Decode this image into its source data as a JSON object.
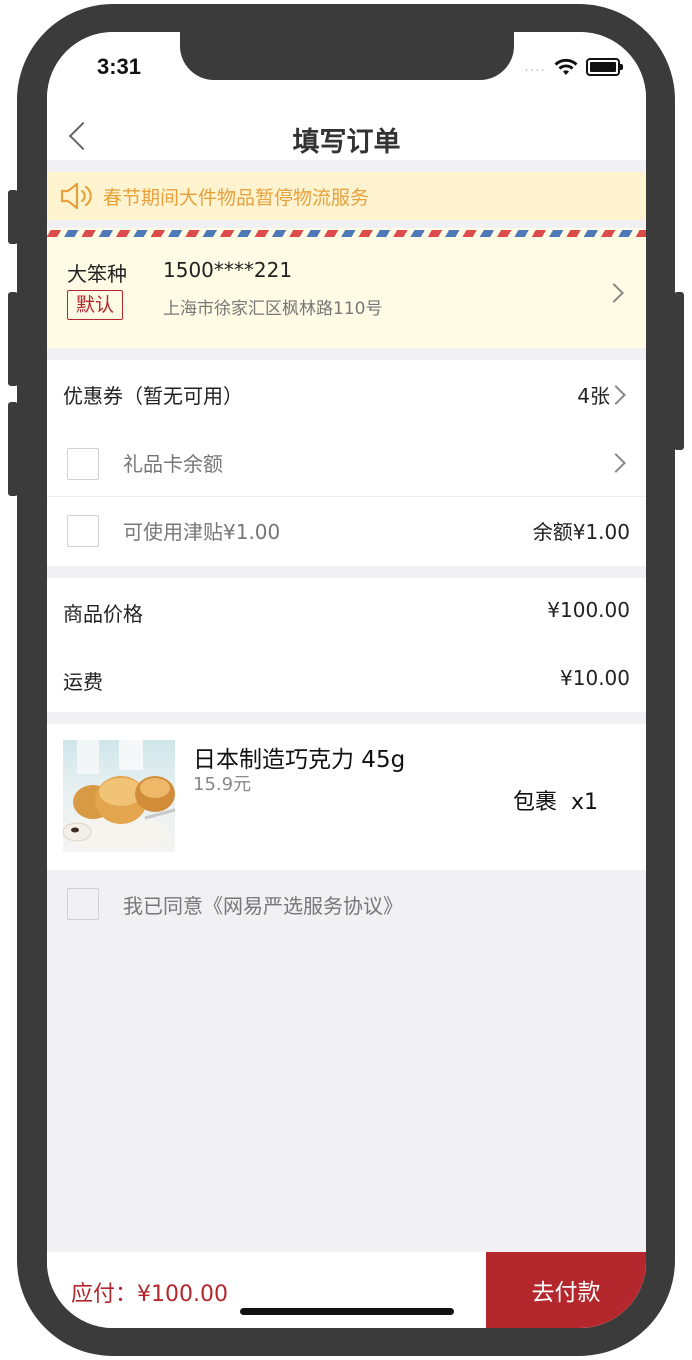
{
  "status_bar": {
    "time": "3:31",
    "signal": "....",
    "wifi_icon": "wifi-icon",
    "battery_icon": "battery-icon"
  },
  "nav": {
    "title": "填写订单",
    "back_icon": "chevron-left-icon"
  },
  "notice": {
    "icon": "speaker-icon",
    "text": "春节期间大件物品暂停物流服务"
  },
  "address": {
    "name": "大笨种",
    "phone": "1500****221",
    "badge": "默认",
    "detail": "上海市徐家汇区枫林路110号"
  },
  "discounts": {
    "coupon_label": "优惠券（暂无可用）",
    "coupon_count": "4张",
    "gift_card_label": "礼品卡余额",
    "allowance_label": "可使用津贴¥1.00",
    "allowance_balance": "余额¥1.00"
  },
  "prices": {
    "goods_label": "商品价格",
    "goods_value": "¥100.00",
    "shipping_label": "运费",
    "shipping_value": "¥10.00"
  },
  "product": {
    "name": "日本制造巧克力 45g",
    "price": "15.9元",
    "package_qty": "包裹  x1"
  },
  "agreement": {
    "text": "我已同意《网易严选服务协议》"
  },
  "footer": {
    "amount": "应付：¥100.00",
    "pay_button": "去付款"
  },
  "colors": {
    "accent": "#b4282d",
    "notice_bg": "#fff4cf",
    "notice_text": "#e8a03d",
    "address_bg": "#fffbe5"
  }
}
